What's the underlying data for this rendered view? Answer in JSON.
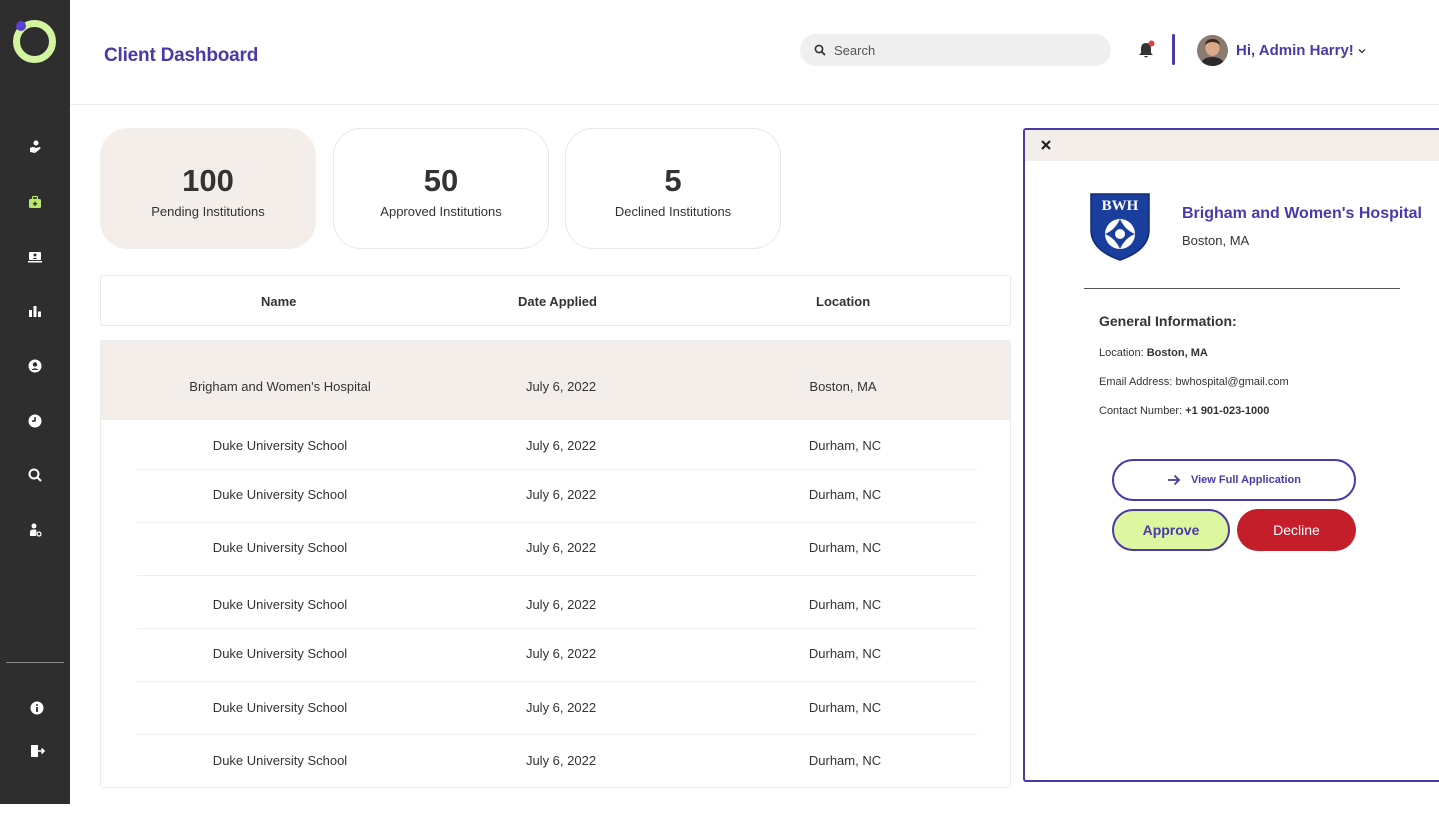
{
  "header": {
    "title": "Client Dashboard",
    "search_placeholder": "Search",
    "greeting": "Hi, Admin Harry!"
  },
  "sidebar": {
    "items": [
      {
        "name": "caregiver-icon"
      },
      {
        "name": "medical-bag-icon",
        "active": true
      },
      {
        "name": "monitor-user-icon"
      },
      {
        "name": "bar-chart-icon"
      },
      {
        "name": "user-circle-icon"
      },
      {
        "name": "clock-icon"
      },
      {
        "name": "search-icon"
      },
      {
        "name": "user-settings-icon"
      }
    ],
    "bottom": [
      {
        "name": "info-icon"
      },
      {
        "name": "logout-icon"
      }
    ]
  },
  "stats": [
    {
      "value": "100",
      "label": "Pending Institutions"
    },
    {
      "value": "50",
      "label": "Approved Institutions"
    },
    {
      "value": "5",
      "label": "Declined Institutions"
    }
  ],
  "table": {
    "columns": [
      "Name",
      "Date Applied",
      "Location"
    ],
    "rows": [
      {
        "name": "Brigham and Women's Hospital",
        "date": "July 6, 2022",
        "location": "Boston, MA"
      },
      {
        "name": "Duke University School",
        "date": "July 6, 2022",
        "location": "Durham, NC"
      },
      {
        "name": "Duke University School",
        "date": "July 6, 2022",
        "location": "Durham, NC"
      },
      {
        "name": "Duke University School",
        "date": "July 6, 2022",
        "location": "Durham, NC"
      },
      {
        "name": "Duke University School",
        "date": "July 6, 2022",
        "location": "Durham, NC"
      },
      {
        "name": "Duke University School",
        "date": "July 6, 2022",
        "location": "Durham, NC"
      },
      {
        "name": "Duke University School",
        "date": "July 6, 2022",
        "location": "Durham, NC"
      },
      {
        "name": "Duke University School",
        "date": "July 6, 2022",
        "location": "Durham, NC"
      }
    ]
  },
  "detail": {
    "logo_text": "BWH",
    "name": "Brigham and Women's Hospital",
    "location": "Boston, MA",
    "section_title": "General Information:",
    "location_label": "Location:",
    "location_value": "Boston, MA",
    "email_label": "Email Address:",
    "email_value": "bwhospital@gmail.com",
    "contact_label": "Contact Number:",
    "contact_value": "+1 901-023-1000",
    "view_label": "View Full Application",
    "approve_label": "Approve",
    "decline_label": "Decline"
  },
  "colors": {
    "accent": "#4a3aa8",
    "sidebar": "#2e2e2e",
    "active_green": "#c8f07a",
    "selected_row": "#f3eeea",
    "approve": "#dcf79f",
    "decline": "#c41e2a"
  }
}
